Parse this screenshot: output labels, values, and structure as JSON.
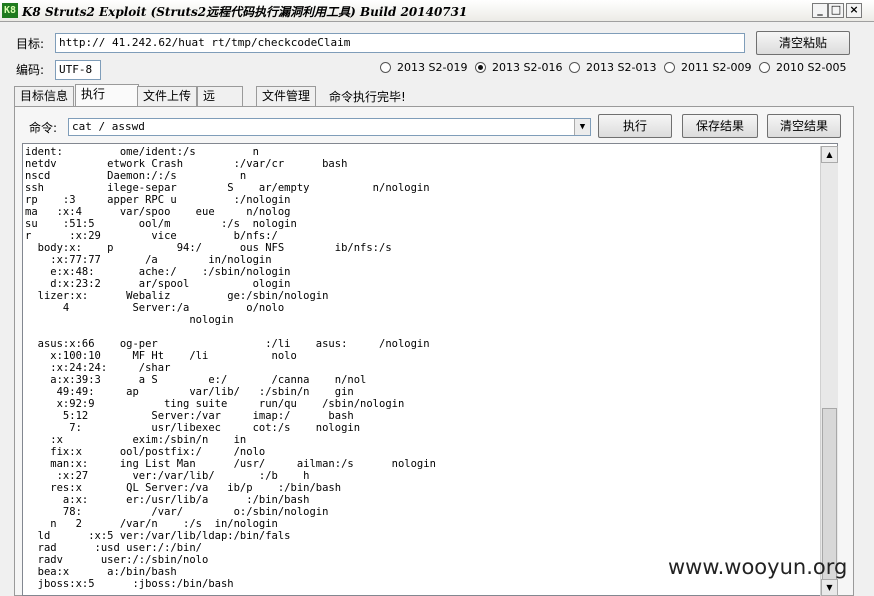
{
  "window": {
    "icon_text": "K8",
    "title": "K8 Struts2 Exploit (Struts2远程代码执行漏洞利用工具)  Build 20140731",
    "minimize": "_",
    "maximize": "□",
    "close": "×"
  },
  "target": {
    "label": "目标:",
    "value": "http://    41.242.62/huat          rt/tmp/checkcodeClaim",
    "clear_paste_button": "清空粘贴"
  },
  "encoding": {
    "label": "编码:",
    "value": "UTF-8"
  },
  "exploit_options": [
    {
      "label": "2013 S2-019",
      "selected": false
    },
    {
      "label": "2013 S2-016",
      "selected": true
    },
    {
      "label": "2013 S2-013",
      "selected": false
    },
    {
      "label": "2011 S2-009",
      "selected": false
    },
    {
      "label": "2010 S2-005",
      "selected": false
    }
  ],
  "tabs": [
    {
      "label": "目标信息",
      "active": false
    },
    {
      "label": "执行",
      "active": true
    },
    {
      "label": "文件上传",
      "active": false
    },
    {
      "label": "远",
      "active": false
    },
    {
      "label": "文件管理",
      "active": false
    }
  ],
  "status_text": "命令执行完毕!",
  "command": {
    "label": "命令:",
    "value": "cat /    asswd",
    "execute_button": "执行",
    "save_button": "保存结果",
    "clear_button": "清空结果"
  },
  "output_lines": [
    "ident:         ome/ident:/s         n",
    "netdv        etwork Crash        :/var/cr      bash",
    "nscd         Daemon:/:/s          n",
    "ssh          ilege-separ        S    ar/empty          n/nologin",
    "rp    :3     apper RPC u         :/nologin",
    "ma   :x:4      var/spoo    eue     n/nolog",
    "su    :51:5       ool/m        :/s  nologin",
    "r      :x:29        vice         b/nfs:/",
    "  body:x:    p          94:/      ous NFS        ib/nfs:/s",
    "    :x:77:77       /a        in/nologin",
    "    e:x:48:       ache:/    :/sbin/nologin",
    "    d:x:23:2      ar/spool          ologin",
    "  lizer:x:      Webaliz         ge:/sbin/nologin",
    "      4          Server:/a         o/nolo",
    "                          nologin",
    "",
    "  asus:x:66    og-per                 :/li    asus:     /nologin",
    "    x:100:10     MF Ht    /li          nolo",
    "    :x:24:24:     /shar",
    "    a:x:39:3      a S        e:/       /canna    n/nol",
    "     49:49:     ap        var/lib/   :/sbin/n    gin",
    "     x:92:9           ting suite     run/qu    /sbin/nologin",
    "      5:12          Server:/var     imap:/      bash",
    "       7:           usr/libexec     cot:/s    nologin",
    "    :x           exim:/sbin/n    in",
    "    fix:x      ool/postfix:/     /nolo",
    "    man:x:     ing List Man      /usr/     ailman:/s      nologin",
    "     :x:27       ver:/var/lib/       :/b    h",
    "    res:x       QL Server:/va   ib/p    :/bin/bash",
    "      a:x:      er:/usr/lib/a      :/bin/bash",
    "      78:           /var/        o:/sbin/nologin",
    "    n   2      /var/n    :/s  in/nologin",
    "  ld      :x:5 ver:/var/lib/ldap:/bin/fals",
    "  rad      :usd user:/:/bin/",
    "  radv      user:/:/sbin/nolo",
    "  bea:x      a:/bin/bash",
    "  jboss:x:5      :jboss:/bin/bash"
  ],
  "watermark": "www.wooyun.org"
}
